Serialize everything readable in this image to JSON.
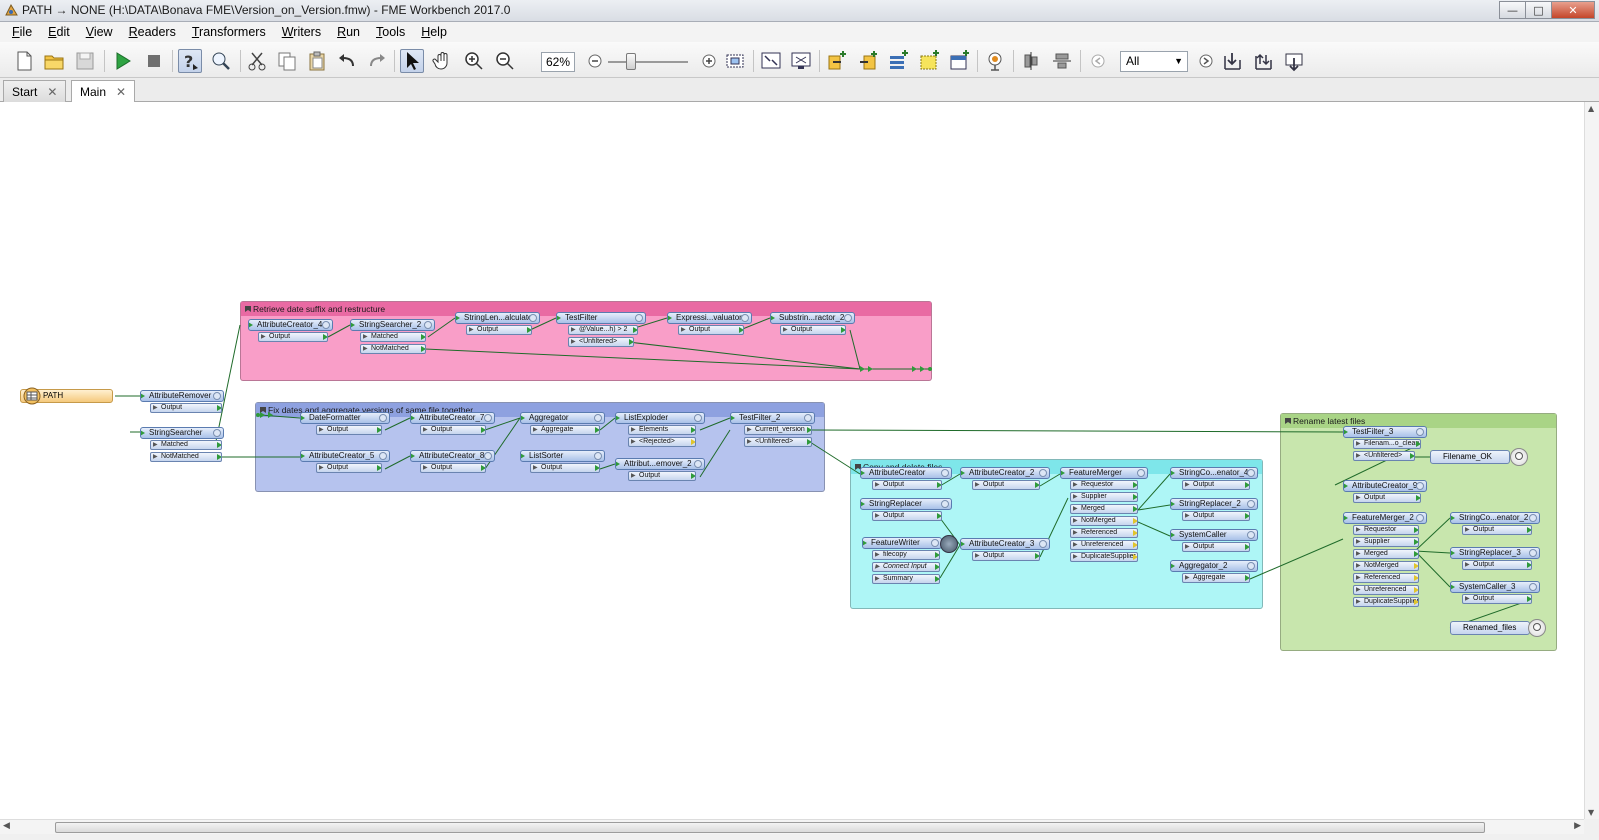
{
  "window": {
    "title": "PATH → NONE (H:\\DATA\\Bonava FME\\Version_on_Version.fmw) - FME Workbench 2017.0",
    "buttons": {
      "minimize": "—",
      "maximize": "□",
      "close": "✕"
    }
  },
  "menu": [
    {
      "u": "F",
      "rest": "ile"
    },
    {
      "u": "E",
      "rest": "dit"
    },
    {
      "u": "V",
      "rest": "iew"
    },
    {
      "u": "R",
      "rest": "eaders"
    },
    {
      "u": "T",
      "rest": "ransformers"
    },
    {
      "u": "W",
      "rest": "riters"
    },
    {
      "u": "R",
      "rest": "un"
    },
    {
      "u": "T",
      "rest": "ools"
    },
    {
      "u": "H",
      "rest": "elp"
    }
  ],
  "toolbar": {
    "zoom_value": "62%",
    "feature_type_filter": "All"
  },
  "tabs": [
    {
      "label": "Start",
      "close": "✕"
    },
    {
      "label": "Main",
      "close": "✕"
    }
  ],
  "bookmarks": {
    "retrieve": {
      "title": "Retrieve date suffix and restructure",
      "color": "#f59ac4"
    },
    "fixdates": {
      "title": "Fix dates and aggregate versions of same file together",
      "color": "#b6c3ee"
    },
    "copydelete": {
      "title": "Copy and delete files",
      "color": "#aef6f6"
    },
    "rename": {
      "title": "Rename latest files",
      "color": "#c8e6ad"
    }
  },
  "reader": {
    "label": "PATH"
  },
  "transformers": {
    "attributeremover": {
      "name": "AttributeRemover",
      "ports": [
        "Output"
      ]
    },
    "stringsearcher": {
      "name": "StringSearcher",
      "ports": [
        "Matched",
        "NotMatched"
      ]
    },
    "attributecreator4": {
      "name": "AttributeCreator_4",
      "ports": [
        "Output"
      ]
    },
    "stringsearcher2": {
      "name": "StringSearcher_2",
      "ports": [
        "Matched",
        "NotMatched"
      ]
    },
    "stringlencalc": {
      "name": "StringLen...alculator",
      "ports": [
        "Output"
      ]
    },
    "testfilter": {
      "name": "TestFilter",
      "ports": [
        "@Value...h) > 2",
        "<Unfiltered>"
      ]
    },
    "exprevaluator": {
      "name": "Expressi...valuator",
      "ports": [
        "Output"
      ]
    },
    "substringextractor2": {
      "name": "Substrin...ractor_2",
      "ports": [
        "Output"
      ]
    },
    "dateformatter": {
      "name": "DateFormatter",
      "ports": [
        "Output"
      ]
    },
    "attributecreator7": {
      "name": "AttributeCreator_7",
      "ports": [
        "Output"
      ]
    },
    "aggregator": {
      "name": "Aggregator",
      "ports": [
        "Aggregate"
      ]
    },
    "listexploder": {
      "name": "ListExploder",
      "ports": [
        "Elements",
        "<Rejected>"
      ]
    },
    "testfilter2": {
      "name": "TestFilter_2",
      "ports": [
        "Current_version",
        "<Unfiltered>"
      ]
    },
    "attributecreator5": {
      "name": "AttributeCreator_5",
      "ports": [
        "Output"
      ]
    },
    "attributecreator8": {
      "name": "AttributeCreator_8",
      "ports": [
        "Output"
      ]
    },
    "listsorter": {
      "name": "ListSorter",
      "ports": [
        "Output"
      ]
    },
    "attributeremover2": {
      "name": "Attribut...emover_2",
      "ports": [
        "Output"
      ]
    },
    "attributecreator": {
      "name": "AttributeCreator",
      "ports": [
        "Output"
      ]
    },
    "attributecreator2": {
      "name": "AttributeCreator_2",
      "ports": [
        "Output"
      ]
    },
    "featuremerger": {
      "name": "FeatureMerger",
      "ports": [
        "Requestor",
        "Supplier",
        "Merged",
        "NotMerged",
        "Referenced",
        "Unreferenced",
        "DuplicateSupplier"
      ]
    },
    "stringconcat4": {
      "name": "StringCo...enator_4",
      "ports": [
        "Output"
      ]
    },
    "stringreplacer": {
      "name": "StringReplacer",
      "ports": [
        "Output"
      ]
    },
    "stringreplacer2": {
      "name": "StringReplacer_2",
      "ports": [
        "Output"
      ]
    },
    "featurewriter": {
      "name": "FeatureWriter",
      "ports": [
        "filecopy",
        "Connect Input",
        "Summary"
      ]
    },
    "attributecreator3": {
      "name": "AttributeCreator_3",
      "ports": [
        "Output"
      ]
    },
    "systemcaller": {
      "name": "SystemCaller",
      "ports": [
        "Output"
      ]
    },
    "aggregator2": {
      "name": "Aggregator_2",
      "ports": [
        "Aggregate"
      ]
    },
    "testfilter3": {
      "name": "TestFilter_3",
      "ports": [
        "Filenam...o_clean",
        "<Unfiltered>"
      ]
    },
    "attributecreator9": {
      "name": "AttributeCreator_9",
      "ports": [
        "Output"
      ]
    },
    "featuremerger2": {
      "name": "FeatureMerger_2",
      "ports": [
        "Requestor",
        "Supplier",
        "Merged",
        "NotMerged",
        "Referenced",
        "Unreferenced",
        "DuplicateSupplier"
      ]
    },
    "stringconcat2": {
      "name": "StringCo...enator_2",
      "ports": [
        "Output"
      ]
    },
    "stringreplacer3": {
      "name": "StringReplacer_3",
      "ports": [
        "Output"
      ]
    },
    "systemcaller3": {
      "name": "SystemCaller_3",
      "ports": [
        "Output"
      ]
    }
  },
  "writers": {
    "filename_ok": {
      "label": "Filename_OK"
    },
    "renamed_files": {
      "label": "Renamed_files"
    }
  }
}
